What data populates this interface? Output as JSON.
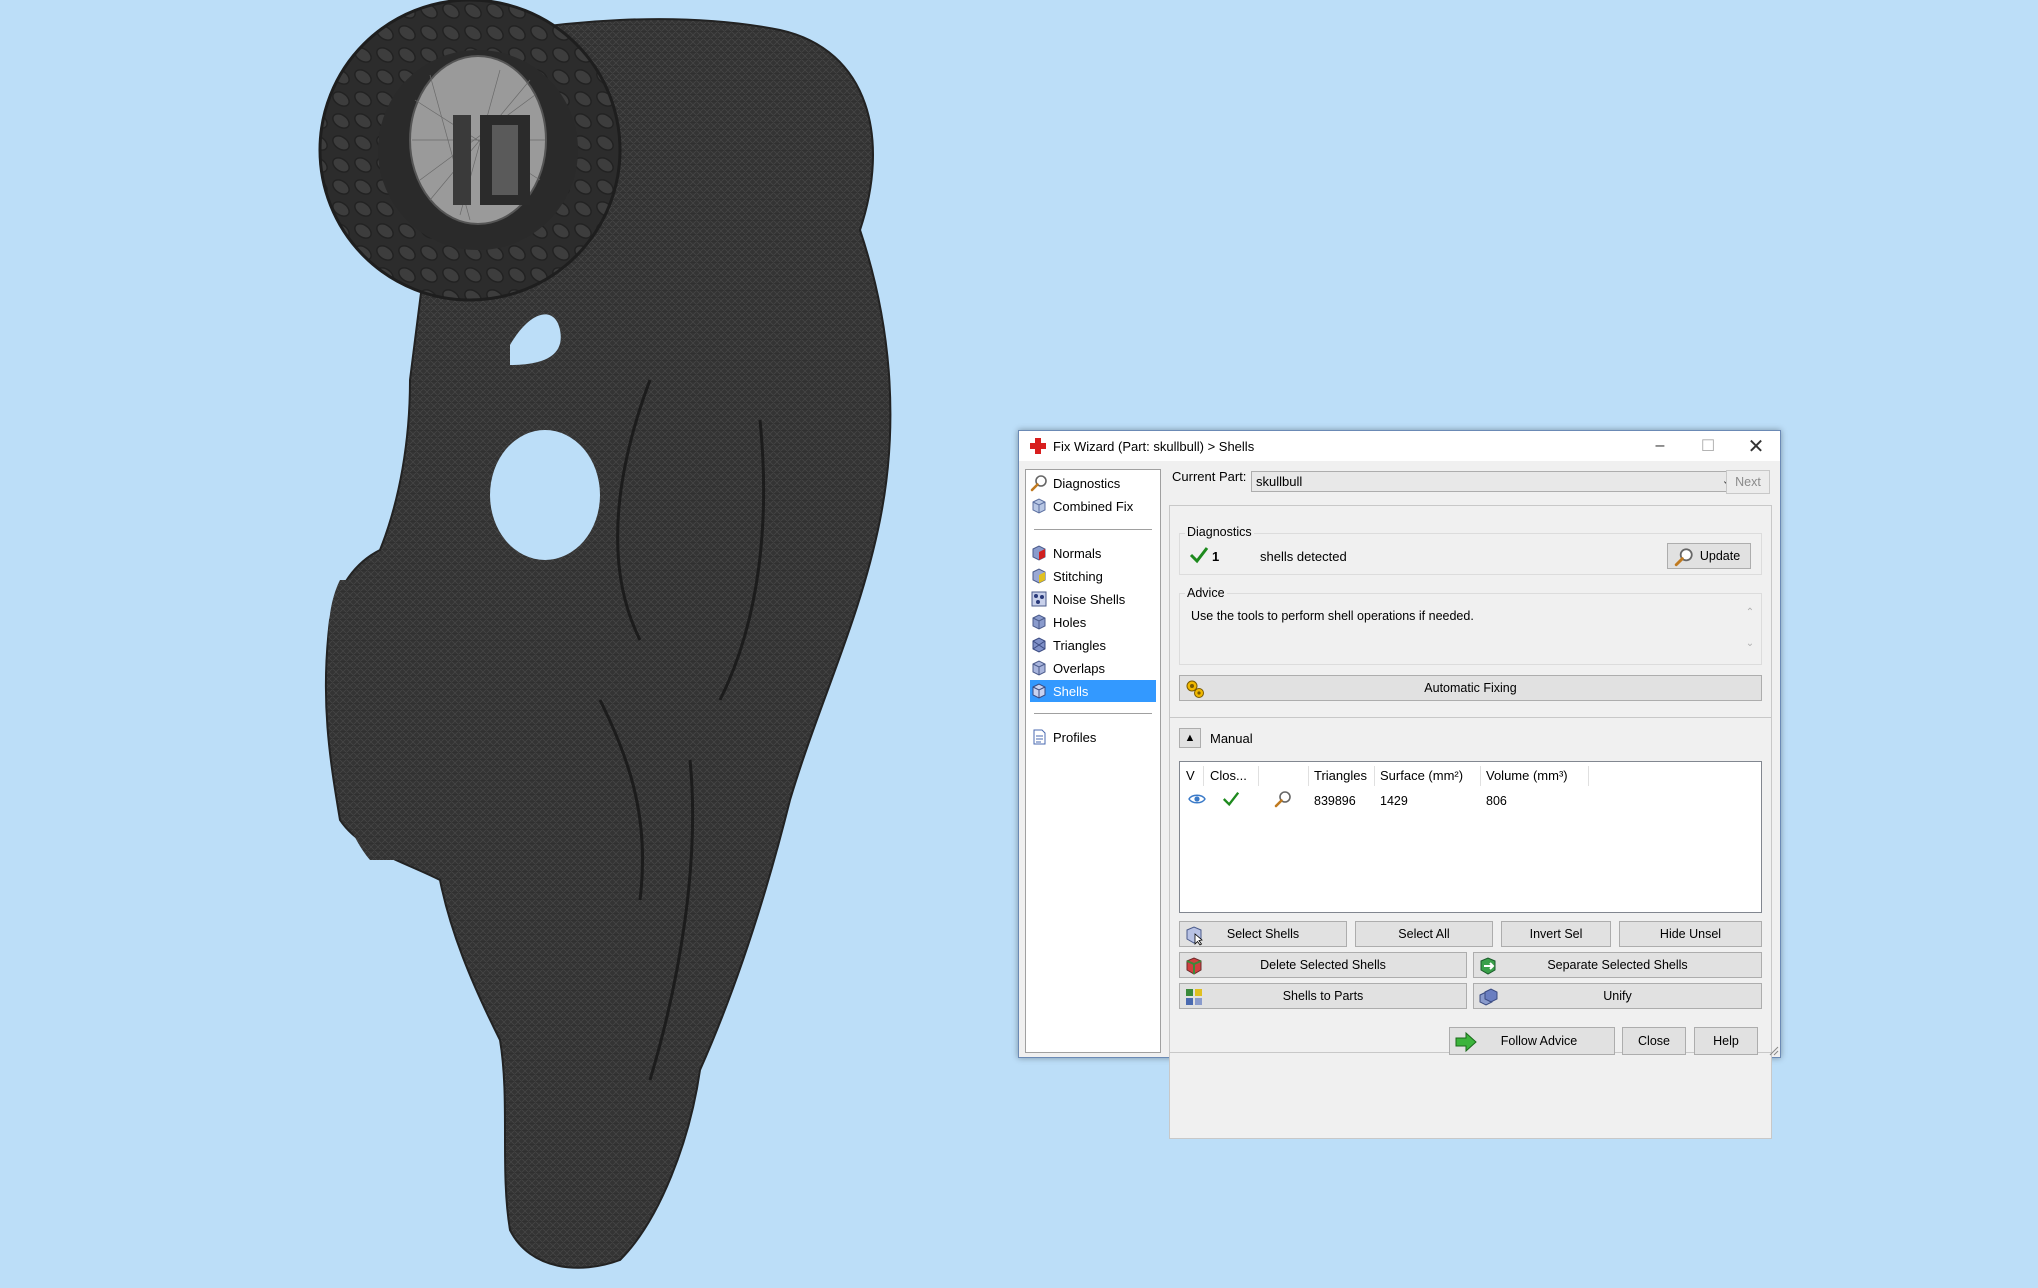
{
  "dialog": {
    "title": "Fix Wizard (Part: skullbull) > Shells",
    "minimize_glyph": "–",
    "maximize_glyph": "☐",
    "close_glyph": "✕"
  },
  "nav": {
    "items_top": [
      {
        "label": "Diagnostics",
        "icon": "magnifier-icon"
      },
      {
        "label": "Combined Fix",
        "icon": "cube-icon"
      }
    ],
    "items_mid": [
      {
        "label": "Normals",
        "icon": "normals-cube-icon"
      },
      {
        "label": "Stitching",
        "icon": "stitching-cube-icon"
      },
      {
        "label": "Noise Shells",
        "icon": "noise-shells-icon"
      },
      {
        "label": "Holes",
        "icon": "holes-cube-icon"
      },
      {
        "label": "Triangles",
        "icon": "triangles-cube-icon"
      },
      {
        "label": "Overlaps",
        "icon": "overlaps-cube-icon"
      },
      {
        "label": "Shells",
        "icon": "shells-cube-icon",
        "selected": true
      }
    ],
    "items_bottom": [
      {
        "label": "Profiles",
        "icon": "document-icon"
      }
    ]
  },
  "current_part": {
    "label": "Current Part:",
    "value": "skullbull",
    "next_label": "Next"
  },
  "diagnostics": {
    "title": "Diagnostics",
    "count": "1",
    "text": "shells detected",
    "update_label": "Update"
  },
  "advice": {
    "title": "Advice",
    "text": "Use the tools to perform shell operations if needed.",
    "auto_fix_label": "Automatic Fixing"
  },
  "manual": {
    "title": "Manual",
    "columns": [
      "V",
      "Clos...",
      "",
      "Triangles",
      "Surface (mm²)",
      "Volume (mm³)"
    ],
    "rows": [
      {
        "triangles": "839896",
        "surface": "1429",
        "volume": "806"
      }
    ],
    "buttons": {
      "select_shells": "Select Shells",
      "select_all": "Select All",
      "invert_sel": "Invert Sel",
      "hide_unsel": "Hide Unsel",
      "delete_selected": "Delete Selected Shells",
      "separate_selected": "Separate Selected Shells",
      "shells_to_parts": "Shells to Parts",
      "unify": "Unify"
    }
  },
  "footer": {
    "follow_advice": "Follow Advice",
    "close": "Close",
    "help": "Help"
  },
  "colors": {
    "background": "#bcdef8",
    "mesh": "#353535",
    "selection": "#3399ff"
  }
}
